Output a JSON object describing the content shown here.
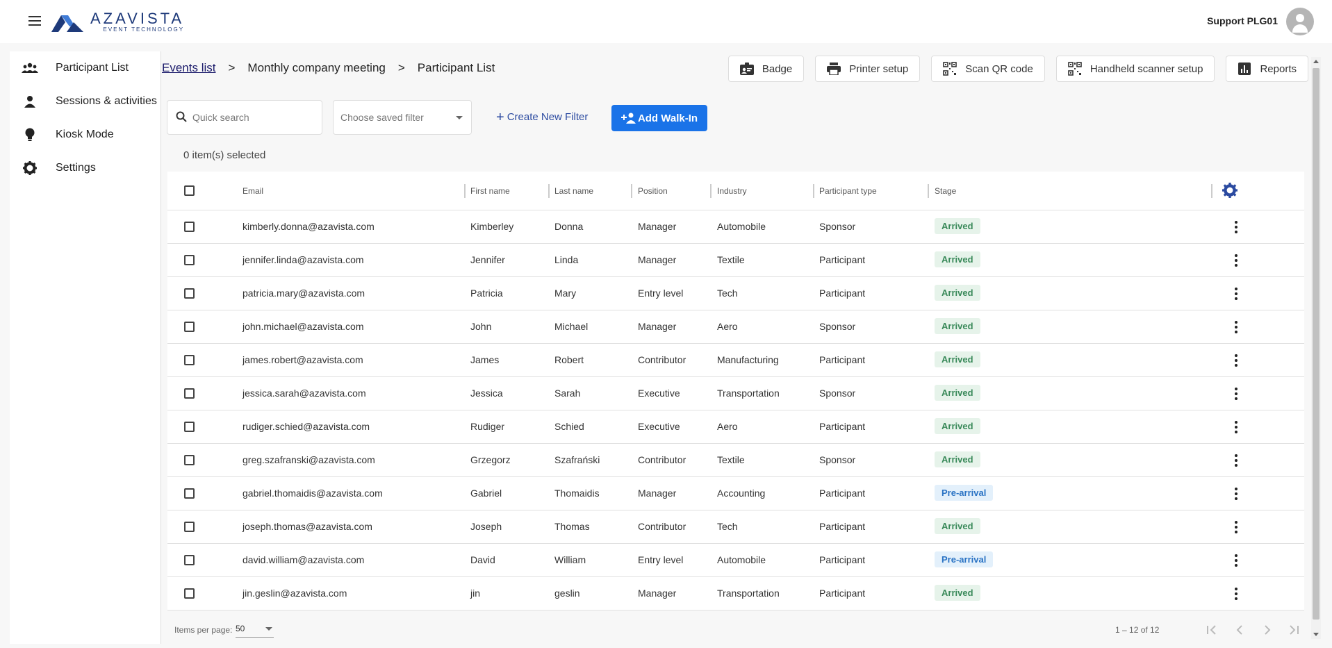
{
  "header": {
    "logo_name": "AZAVISTA",
    "logo_tagline": "EVENT TECHNOLOGY",
    "user_name": "Support PLG01"
  },
  "sidebar": {
    "items": [
      {
        "label": "Participant List",
        "icon": "people-icon"
      },
      {
        "label": "Sessions & activities",
        "icon": "person-icon"
      },
      {
        "label": "Kiosk Mode",
        "icon": "lightbulb-icon"
      },
      {
        "label": "Settings",
        "icon": "gear-icon"
      }
    ]
  },
  "breadcrumb": {
    "root": "Events list",
    "separator": ">",
    "event": "Monthly company meeting",
    "current": "Participant List"
  },
  "toolbar": {
    "badge": "Badge",
    "printer_setup": "Printer setup",
    "scan_qr": "Scan QR code",
    "handheld": "Handheld scanner setup",
    "reports": "Reports"
  },
  "filters": {
    "search_placeholder": "Quick search",
    "saved_filter_placeholder": "Choose saved filter",
    "create_filter": "Create New Filter",
    "add_walkin": "Add Walk-In",
    "selected_count": "0 item(s) selected"
  },
  "table": {
    "columns": [
      "Email",
      "First name",
      "Last name",
      "Position",
      "Industry",
      "Participant type",
      "Stage"
    ],
    "rows": [
      {
        "email": "kimberly.donna@azavista.com",
        "first": "Kimberley",
        "last": "Donna",
        "position": "Manager",
        "industry": "Automobile",
        "type": "Sponsor",
        "stage": "Arrived"
      },
      {
        "email": "jennifer.linda@azavista.com",
        "first": "Jennifer",
        "last": "Linda",
        "position": "Manager",
        "industry": "Textile",
        "type": "Participant",
        "stage": "Arrived"
      },
      {
        "email": "patricia.mary@azavista.com",
        "first": "Patricia",
        "last": "Mary",
        "position": "Entry level",
        "industry": "Tech",
        "type": "Participant",
        "stage": "Arrived"
      },
      {
        "email": "john.michael@azavista.com",
        "first": "John",
        "last": "Michael",
        "position": "Manager",
        "industry": "Aero",
        "type": "Sponsor",
        "stage": "Arrived"
      },
      {
        "email": "james.robert@azavista.com",
        "first": "James",
        "last": "Robert",
        "position": "Contributor",
        "industry": "Manufacturing",
        "type": "Participant",
        "stage": "Arrived"
      },
      {
        "email": "jessica.sarah@azavista.com",
        "first": "Jessica",
        "last": "Sarah",
        "position": "Executive",
        "industry": "Transportation",
        "type": "Sponsor",
        "stage": "Arrived"
      },
      {
        "email": "rudiger.schied@azavista.com",
        "first": "Rudiger",
        "last": "Schied",
        "position": "Executive",
        "industry": "Aero",
        "type": "Participant",
        "stage": "Arrived"
      },
      {
        "email": "greg.szafranski@azavista.com",
        "first": "Grzegorz",
        "last": "Szafrański",
        "position": "Contributor",
        "industry": "Textile",
        "type": "Sponsor",
        "stage": "Arrived"
      },
      {
        "email": "gabriel.thomaidis@azavista.com",
        "first": "Gabriel",
        "last": "Thomaidis",
        "position": "Manager",
        "industry": "Accounting",
        "type": "Participant",
        "stage": "Pre-arrival"
      },
      {
        "email": "joseph.thomas@azavista.com",
        "first": "Joseph",
        "last": "Thomas",
        "position": "Contributor",
        "industry": "Tech",
        "type": "Participant",
        "stage": "Arrived"
      },
      {
        "email": "david.william@azavista.com",
        "first": "David",
        "last": "William",
        "position": "Entry level",
        "industry": "Automobile",
        "type": "Participant",
        "stage": "Pre-arrival"
      },
      {
        "email": "jin.geslin@azavista.com",
        "first": "jin",
        "last": "geslin",
        "position": "Manager",
        "industry": "Transportation",
        "type": "Participant",
        "stage": "Arrived"
      }
    ]
  },
  "paginator": {
    "label": "Items per page:",
    "page_size": "50",
    "range": "1 – 12 of 12"
  },
  "colors": {
    "brand": "#1e3a7a",
    "accent": "#1a73e8",
    "arrived_bg": "#e6f3ea",
    "arrived_text": "#3a8a5a",
    "prearrival_bg": "#e3f0fb",
    "prearrival_text": "#2a73c4"
  }
}
